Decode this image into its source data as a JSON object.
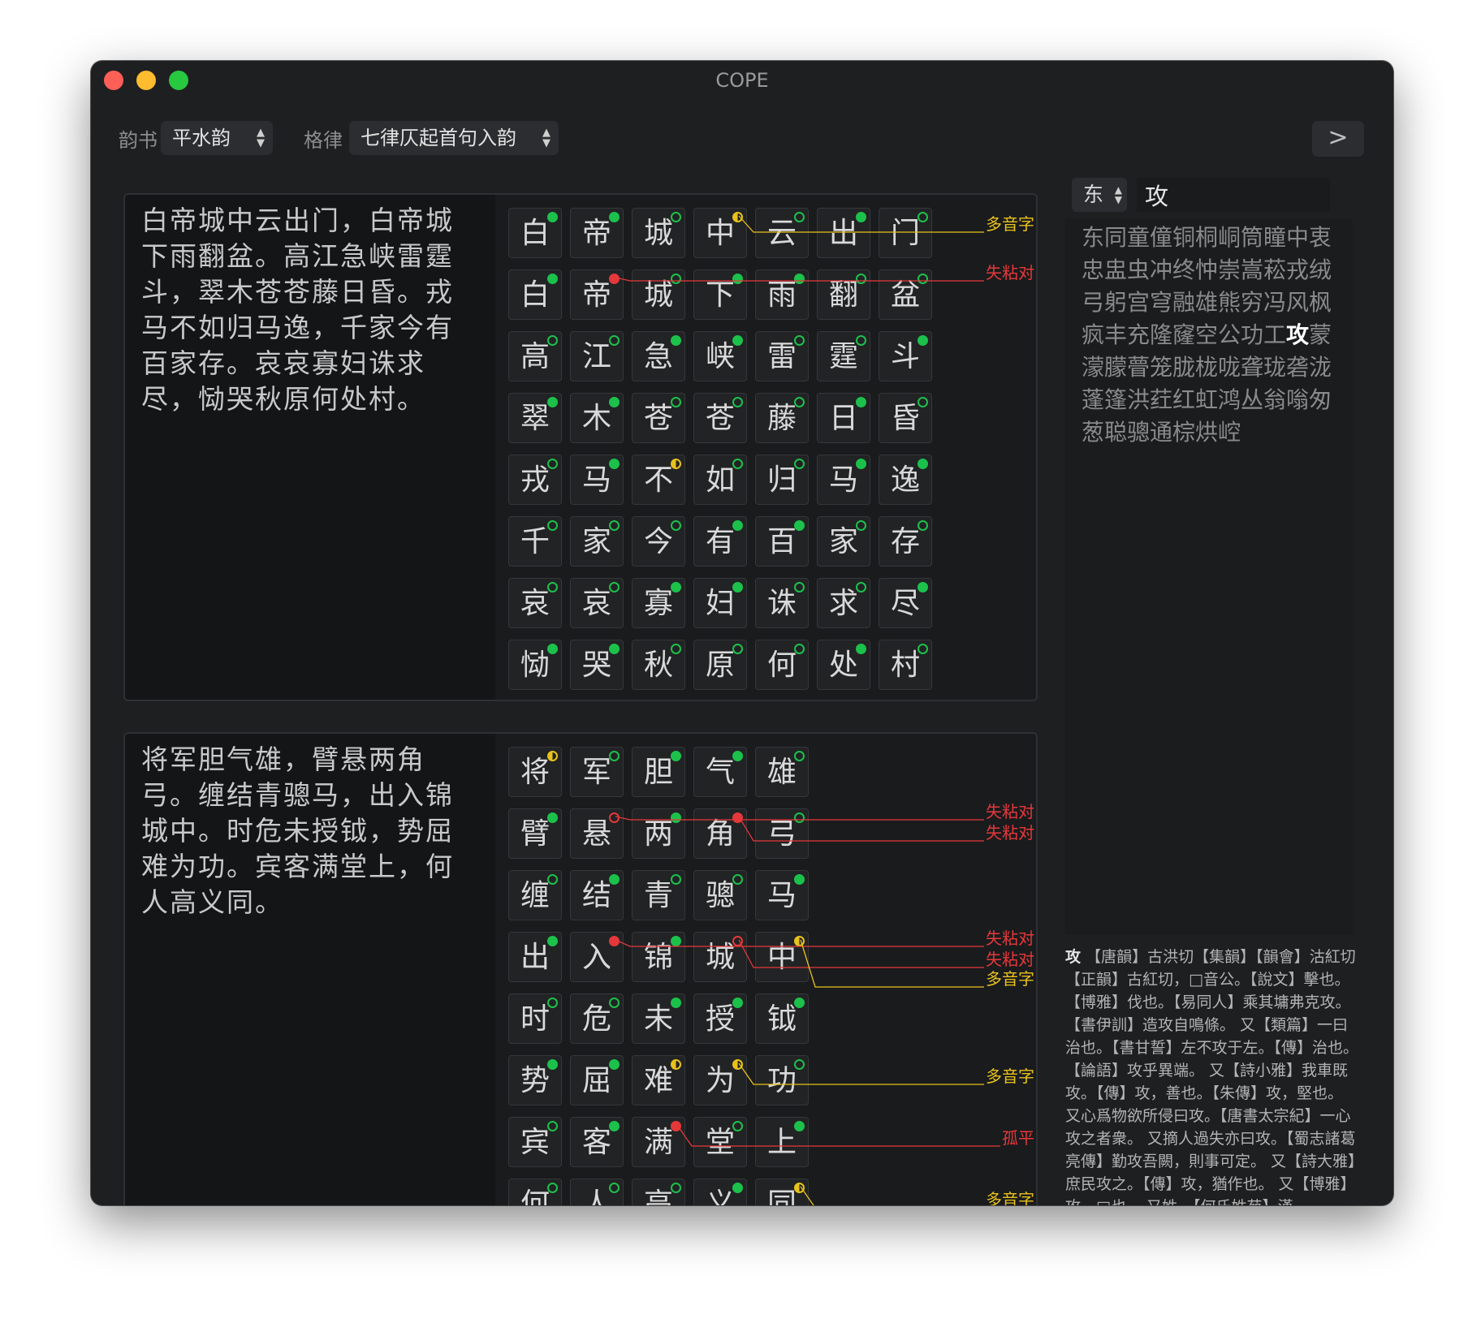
{
  "window": {
    "title": "COPE"
  },
  "toolbar": {
    "rhyme_book_label": "韵书",
    "rhyme_book_value": "平水韵",
    "meter_label": "格律",
    "meter_value": "七律仄起首句入韵",
    "next_glyph": ">"
  },
  "poems": [
    {
      "text": "白帝城中云出门，白帝城下雨翻盆。高江急峡雷霆斗，翠木苍苍藤日昏。戎马不如归马逸，千家今有百家存。哀哀寡妇诛求尽，恸哭秋原何处村。",
      "rows": [
        [
          [
            "白",
            "pf"
          ],
          [
            "帝",
            "pf"
          ],
          [
            "城",
            "po"
          ],
          [
            "中",
            "yh"
          ],
          [
            "云",
            "po"
          ],
          [
            "出",
            "pf"
          ],
          [
            "门",
            "po"
          ]
        ],
        [
          [
            "白",
            "pf"
          ],
          [
            "帝",
            "rf"
          ],
          [
            "城",
            "po"
          ],
          [
            "下",
            "pf"
          ],
          [
            "雨",
            "pf"
          ],
          [
            "翻",
            "po"
          ],
          [
            "盆",
            "po"
          ]
        ],
        [
          [
            "高",
            "po"
          ],
          [
            "江",
            "po"
          ],
          [
            "急",
            "pf"
          ],
          [
            "峡",
            "pf"
          ],
          [
            "雷",
            "po"
          ],
          [
            "霆",
            "po"
          ],
          [
            "斗",
            "pf"
          ]
        ],
        [
          [
            "翠",
            "pf"
          ],
          [
            "木",
            "pf"
          ],
          [
            "苍",
            "po"
          ],
          [
            "苍",
            "po"
          ],
          [
            "藤",
            "po"
          ],
          [
            "日",
            "pf"
          ],
          [
            "昏",
            "po"
          ]
        ],
        [
          [
            "戎",
            "po"
          ],
          [
            "马",
            "pf"
          ],
          [
            "不",
            "yh"
          ],
          [
            "如",
            "po"
          ],
          [
            "归",
            "po"
          ],
          [
            "马",
            "pf"
          ],
          [
            "逸",
            "pf"
          ]
        ],
        [
          [
            "千",
            "po"
          ],
          [
            "家",
            "po"
          ],
          [
            "今",
            "po"
          ],
          [
            "有",
            "pf"
          ],
          [
            "百",
            "pf"
          ],
          [
            "家",
            "po"
          ],
          [
            "存",
            "po"
          ]
        ],
        [
          [
            "哀",
            "po"
          ],
          [
            "哀",
            "po"
          ],
          [
            "寡",
            "pf"
          ],
          [
            "妇",
            "pf"
          ],
          [
            "诛",
            "po"
          ],
          [
            "求",
            "po"
          ],
          [
            "尽",
            "pf"
          ]
        ],
        [
          [
            "恸",
            "pf"
          ],
          [
            "哭",
            "pf"
          ],
          [
            "秋",
            "po"
          ],
          [
            "原",
            "po"
          ],
          [
            "何",
            "po"
          ],
          [
            "处",
            "pf"
          ],
          [
            "村",
            "po"
          ]
        ]
      ],
      "tags": [
        {
          "text": "多音字",
          "color": "yellow"
        },
        {
          "text": "失粘对",
          "color": "red"
        }
      ]
    },
    {
      "text": "将军胆气雄，臂悬两角弓。缠结青骢马，出入锦城中。时危未授钺，势屈难为功。宾客满堂上，何人高义同。",
      "rows": [
        [
          [
            "将",
            "yh"
          ],
          [
            "军",
            "po"
          ],
          [
            "胆",
            "pf"
          ],
          [
            "气",
            "pf"
          ],
          [
            "雄",
            "po"
          ]
        ],
        [
          [
            "臂",
            "pf"
          ],
          [
            "悬",
            "ro"
          ],
          [
            "两",
            "pf"
          ],
          [
            "角",
            "rf"
          ],
          [
            "弓",
            "po"
          ]
        ],
        [
          [
            "缠",
            "po"
          ],
          [
            "结",
            "pf"
          ],
          [
            "青",
            "po"
          ],
          [
            "骢",
            "po"
          ],
          [
            "马",
            "pf"
          ]
        ],
        [
          [
            "出",
            "pf"
          ],
          [
            "入",
            "rf"
          ],
          [
            "锦",
            "pf"
          ],
          [
            "城",
            "ro"
          ],
          [
            "中",
            "yh"
          ]
        ],
        [
          [
            "时",
            "po"
          ],
          [
            "危",
            "po"
          ],
          [
            "未",
            "pf"
          ],
          [
            "授",
            "pf"
          ],
          [
            "钺",
            "pf"
          ]
        ],
        [
          [
            "势",
            "pf"
          ],
          [
            "屈",
            "pf"
          ],
          [
            "难",
            "yh"
          ],
          [
            "为",
            "yh"
          ],
          [
            "功",
            "po"
          ]
        ],
        [
          [
            "宾",
            "po"
          ],
          [
            "客",
            "pf"
          ],
          [
            "满",
            "rf"
          ],
          [
            "堂",
            "po"
          ],
          [
            "上",
            "pf"
          ]
        ],
        [
          [
            "何",
            "po"
          ],
          [
            "人",
            "po"
          ],
          [
            "高",
            "po"
          ],
          [
            "义",
            "pf"
          ],
          [
            "同",
            "yh"
          ]
        ]
      ],
      "tags": [
        {
          "text": "失粘对",
          "color": "red"
        },
        {
          "text": "失粘对",
          "color": "red"
        },
        {
          "text": "失粘对",
          "color": "red"
        },
        {
          "text": "失粘对",
          "color": "red"
        },
        {
          "text": "多音字",
          "color": "yellow"
        },
        {
          "text": "多音字",
          "color": "yellow"
        },
        {
          "text": "孤平",
          "color": "red"
        },
        {
          "text": "多音字",
          "color": "yellow"
        }
      ]
    }
  ],
  "rhyme_panel": {
    "rhyme_value": "东",
    "search_value": "攻",
    "chars_before": "东同童僮铜桐峒筒瞳中衷忠盅虫冲终忡崇嵩菘戎绒弓躬宫穹融雄熊穷冯风枫疯丰充隆窿空公功工",
    "highlight": "攻",
    "chars_after": "蒙濛朦瞢笼胧栊咙聋珑砻泷蓬篷洪荭红虹鸿丛翁嗡匆葱聪骢通棕烘崆"
  },
  "definition": {
    "head": "攻",
    "body": "【唐韻】古洪切【集韻】【韻會】沽紅切【正韻】古紅切，□音公。【說文】擊也。【博雅】伐也。【易同人】乘其墉弗克攻。【書伊訓】造攻自鳴條。 又【類篇】一曰治也。【書甘誓】左不攻于左。【傳】治也。【論語】攻乎異端。 又【詩小雅】我車既攻。【傳】攻，善也。【朱傳】攻，堅也。 又心爲物欲所侵曰攻。【唐書太宗紀】一心攻之者衆。 又摘人過失亦曰攻。【蜀志諸葛亮傳】勤攻吾闕，則事可定。 又【詩大雅】庶民攻之。【傳】攻，猶作也。 又【博雅】攻，□也。 又姓。【何氏姓苑】漢"
  },
  "colors": {
    "ping_green": "#1cc14b",
    "error_red": "#e5383b",
    "polyphone_yellow": "#e8c21c"
  }
}
